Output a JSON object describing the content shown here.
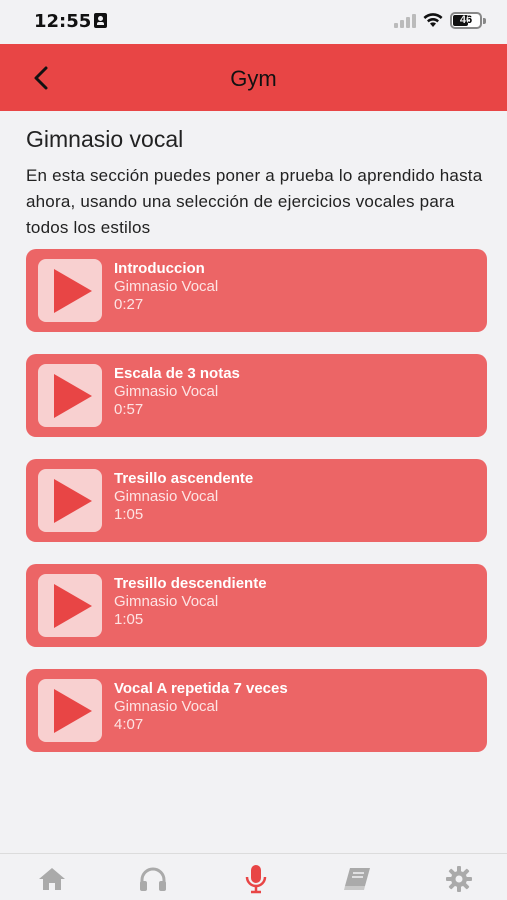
{
  "status_bar": {
    "time": "12:55",
    "battery": "46"
  },
  "nav": {
    "title": "Gym"
  },
  "page": {
    "title": "Gimnasio vocal",
    "description": "En esta sección puedes poner a prueba lo aprendido hasta ahora, usando una selección de ejercicios vocales para todos los estilos"
  },
  "tracks": [
    {
      "title": "Introduccion",
      "subtitle": "Gimnasio Vocal",
      "duration": "0:27"
    },
    {
      "title": "Escala de 3 notas",
      "subtitle": "Gimnasio Vocal",
      "duration": "0:57"
    },
    {
      "title": "Tresillo ascendente",
      "subtitle": "Gimnasio Vocal",
      "duration": "1:05"
    },
    {
      "title": "Tresillo descendiente",
      "subtitle": "Gimnasio Vocal",
      "duration": "1:05"
    },
    {
      "title": "Vocal A repetida 7 veces",
      "subtitle": "Gimnasio Vocal",
      "duration": "4:07"
    }
  ],
  "tab_bar": {
    "items": [
      {
        "icon": "home-icon",
        "active": false
      },
      {
        "icon": "headphones-icon",
        "active": false
      },
      {
        "icon": "microphone-icon",
        "active": true
      },
      {
        "icon": "book-icon",
        "active": false
      },
      {
        "icon": "gear-icon",
        "active": false
      }
    ]
  },
  "colors": {
    "accent": "#e84545",
    "card": "#ec6566",
    "thumb": "#f8d0d0",
    "inactive_tab": "#aaaaaa"
  }
}
